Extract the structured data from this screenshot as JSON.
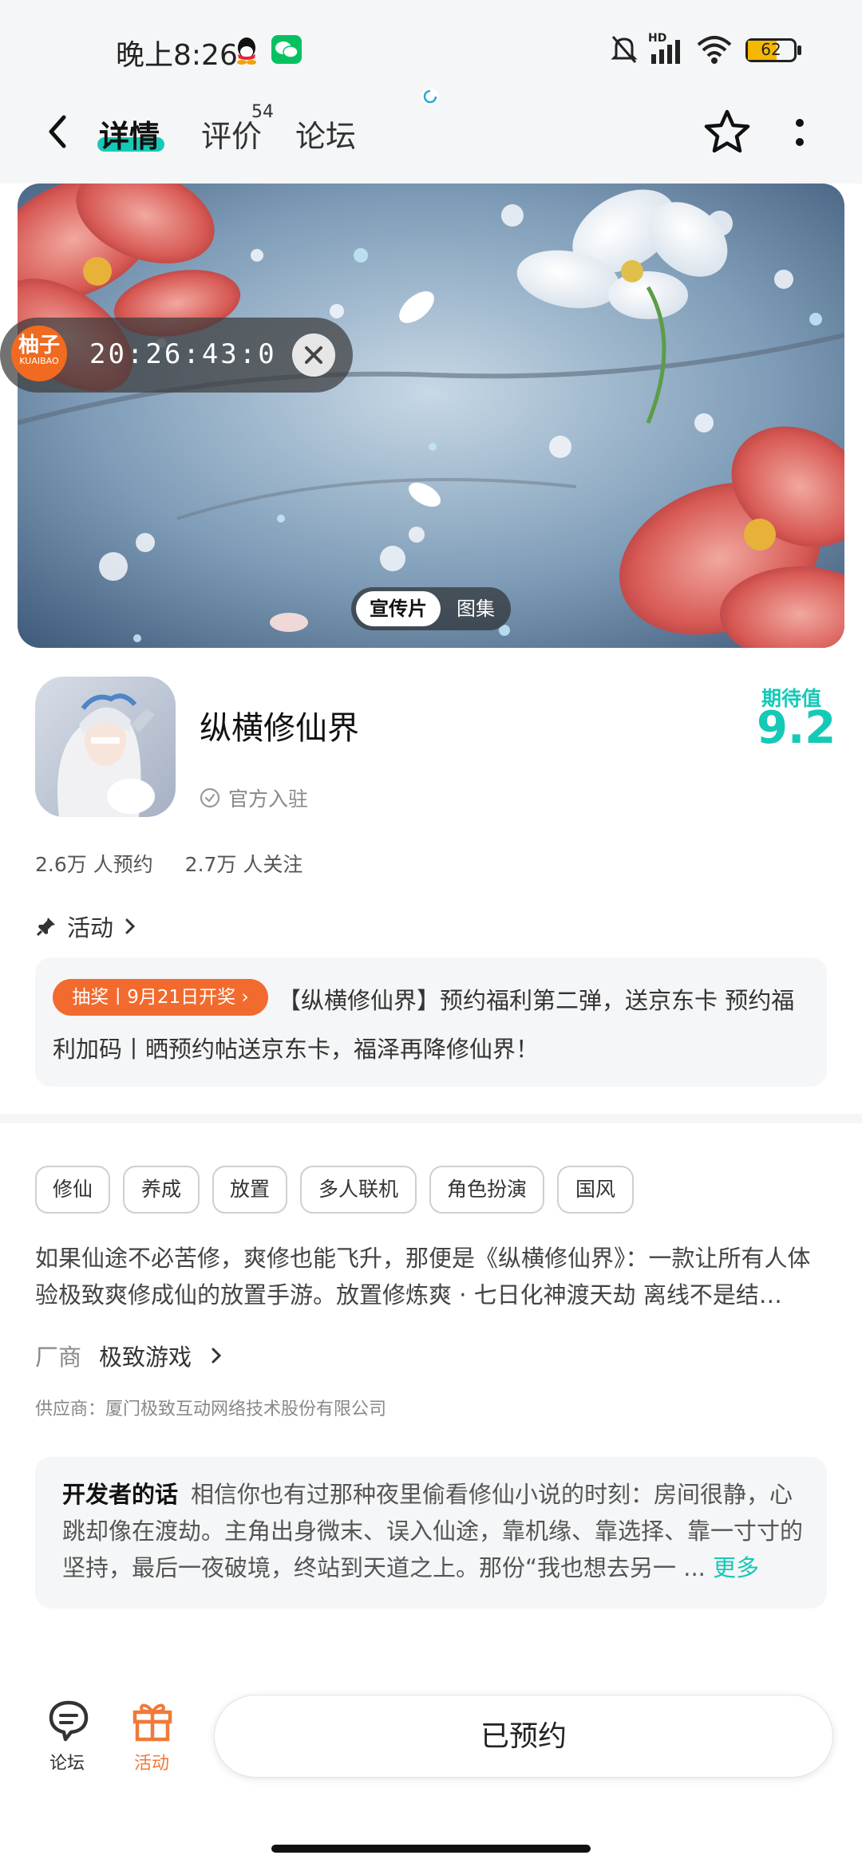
{
  "status_bar": {
    "time": "晚上8:26",
    "network": "HD",
    "battery": "62",
    "icons": [
      "qq-icon",
      "wechat-icon",
      "mute-icon",
      "signal-icon",
      "wifi-icon",
      "battery-icon"
    ]
  },
  "header": {
    "tabs": [
      {
        "label": "详情",
        "active": true
      },
      {
        "label": "评价",
        "count": "54"
      },
      {
        "label": "论坛"
      }
    ]
  },
  "banner": {
    "timer": {
      "logo_main": "柚子",
      "logo_sub": "KUAIBAO",
      "time": "20:26:43:0"
    },
    "media_tabs": [
      "宣传片",
      "图集"
    ]
  },
  "game": {
    "title": "纵横修仙界",
    "official_badge": "官方入驻",
    "expectation_label": "期待值",
    "expectation_score": "9.2",
    "stats": [
      "2.6万 人预约",
      "2.7万 人关注"
    ]
  },
  "activity": {
    "section_label": "活动",
    "badge": "抽奖丨9月21日开奖 ",
    "text": "【纵横修仙界】预约福利第二弹，送京东卡 预约福利加码丨晒预约帖送京东卡，福泽再降修仙界！"
  },
  "tags": [
    "修仙",
    "养成",
    "放置",
    "多人联机",
    "角色扮演",
    "国风"
  ],
  "description": [
    "如果仙途不必苦修，爽修也能飞升，那便是《纵横修仙界》：一款让所有人体",
    "验极致爽修成仙的放置手游。放置修炼爽 · 七日化神渡天劫 离线不是结…"
  ],
  "vendor": {
    "label": "厂商",
    "name": "极致游戏"
  },
  "supplier": "供应商：厦门极致互动网络技术股份有限公司",
  "developer": {
    "label": "开发者的话",
    "text": "相信你也有过那种夜里偷看修仙小说的时刻：房间很静，心跳却像在渡劫。主角出身微末、误入仙途，靠机缘、靠选择、靠一寸寸的坚持，最后一夜破境，终站到天道之上。那份“我也想去另一 ... ",
    "more": "更多"
  },
  "bottom_bar": {
    "forum_label": "论坛",
    "activity_label": "活动",
    "reserve_label": "已预约"
  },
  "colors": {
    "accent": "#15c9b7",
    "orange": "#f26a2e",
    "card_bg": "#f5f6f7"
  }
}
